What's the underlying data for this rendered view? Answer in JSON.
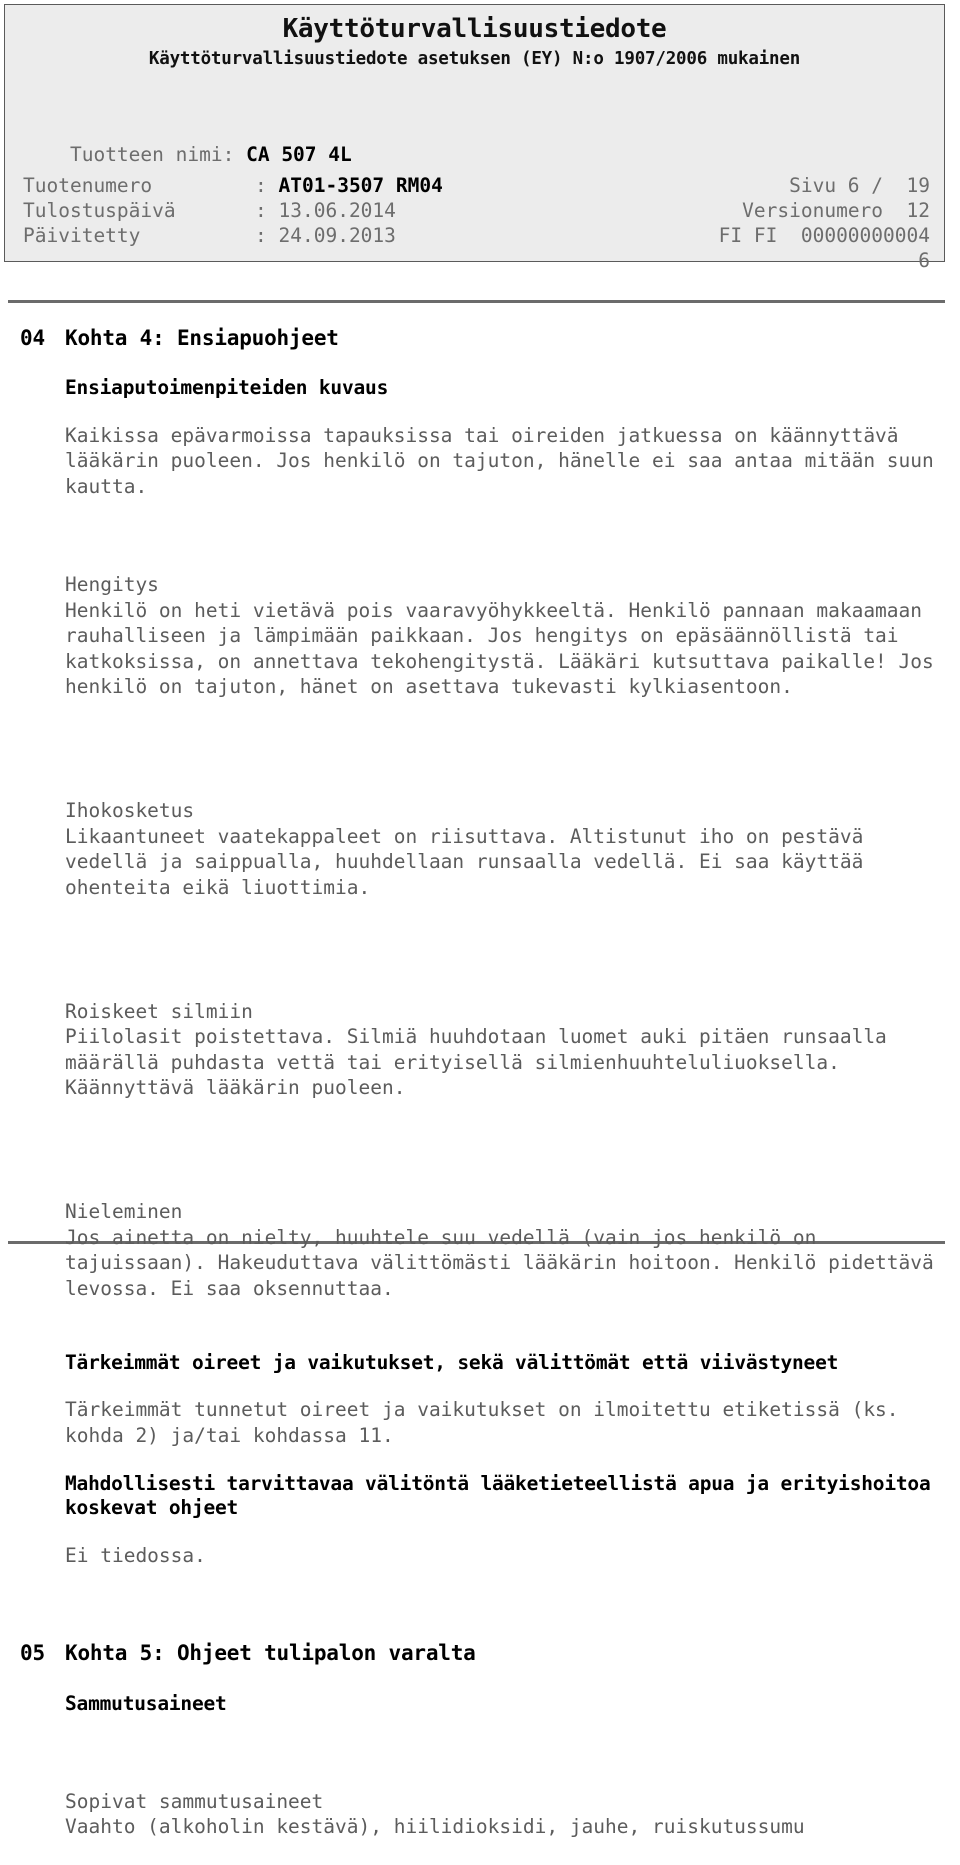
{
  "header": {
    "title": "Käyttöturvallisuustiedote",
    "subtitle": "Käyttöturvallisuustiedote asetuksen (EY) N:o 1907/2006 mukainen",
    "product_label": "Tuotteen nimi:",
    "product_value": "CA 507 4L",
    "rows": [
      {
        "key": "Tuotenumero",
        "sep": ":",
        "value": "AT01-3507 RM04",
        "right": "Sivu 6 /  19"
      },
      {
        "key": "Tulostuspäivä",
        "sep": ":",
        "value": "13.06.2014",
        "right": "Versionumero  12"
      },
      {
        "key": "Päivitetty",
        "sep": ":",
        "value": "24.09.2013",
        "right": "FI FI  00000000004"
      }
    ],
    "trailing_right": "6"
  },
  "section4": {
    "number": "04",
    "title": "Kohta 4: Ensiapuohjeet",
    "subhead_description": "Ensiaputoimenpiteiden kuvaus",
    "intro": "Kaikissa epävarmoissa tapauksissa tai oireiden jatkuessa on käännyttävä lääkärin puoleen. Jos henkilö on tajuton, hänelle ei saa antaa mitään suun kautta.",
    "inhalation_head": "Hengitys",
    "inhalation_text": "Henkilö on heti vietävä pois vaaravyöhykkeeltä. Henkilö pannaan makaamaan rauhalliseen ja lämpimään paikkaan. Jos hengitys on epäsäännöllistä tai katkoksissa, on annettava tekohengitystä. Lääkäri kutsuttava paikalle! Jos henkilö on tajuton, hänet on asettava tukevasti kylkiasentoon.",
    "skin_head": "Ihokosketus",
    "skin_text": "Likaantuneet vaatekappaleet on riisuttava. Altistunut iho on pestävä vedellä ja saippualla, huuhdellaan runsaalla vedellä. Ei saa käyttää ohenteita eikä liuottimia.",
    "eyes_head": "Roiskeet silmiin",
    "eyes_text": "Piilolasit poistettava. Silmiä huuhdotaan luomet auki pitäen runsaalla määrällä puhdasta vettä tai erityisellä silmienhuuhteluliuoksella. Käännyttävä lääkärin puoleen.",
    "ingestion_head": "Nieleminen",
    "ingestion_text": "Jos ainetta on nielty, huuhtele suu vedellä (vain jos henkilö on tajuissaan). Hakeuduttava välittömästi lääkärin hoitoon. Henkilö pidettävä levossa. Ei saa oksennuttaa.",
    "subhead_symptoms": "Tärkeimmät oireet ja vaikutukset, sekä välittömät että viivästyneet",
    "symptoms_text": "Tärkeimmät tunnetut oireet ja vaikutukset on ilmoitettu etiketissä (ks. kohda 2) ja/tai kohdassa 11.",
    "subhead_medical": "Mahdollisesti tarvittavaa välitöntä lääketieteellistä apua ja erityishoitoa koskevat ohjeet",
    "medical_text": "Ei tiedossa."
  },
  "section5": {
    "number": "05",
    "title": "Kohta 5: Ohjeet tulipalon varalta",
    "subhead_extinguishing": "Sammutusaineet",
    "suitable_head": "Sopivat sammutusaineet",
    "suitable_text": "Vaahto (alkoholin kestävä), hiilidioksidi, jauhe, ruiskutussumu"
  }
}
